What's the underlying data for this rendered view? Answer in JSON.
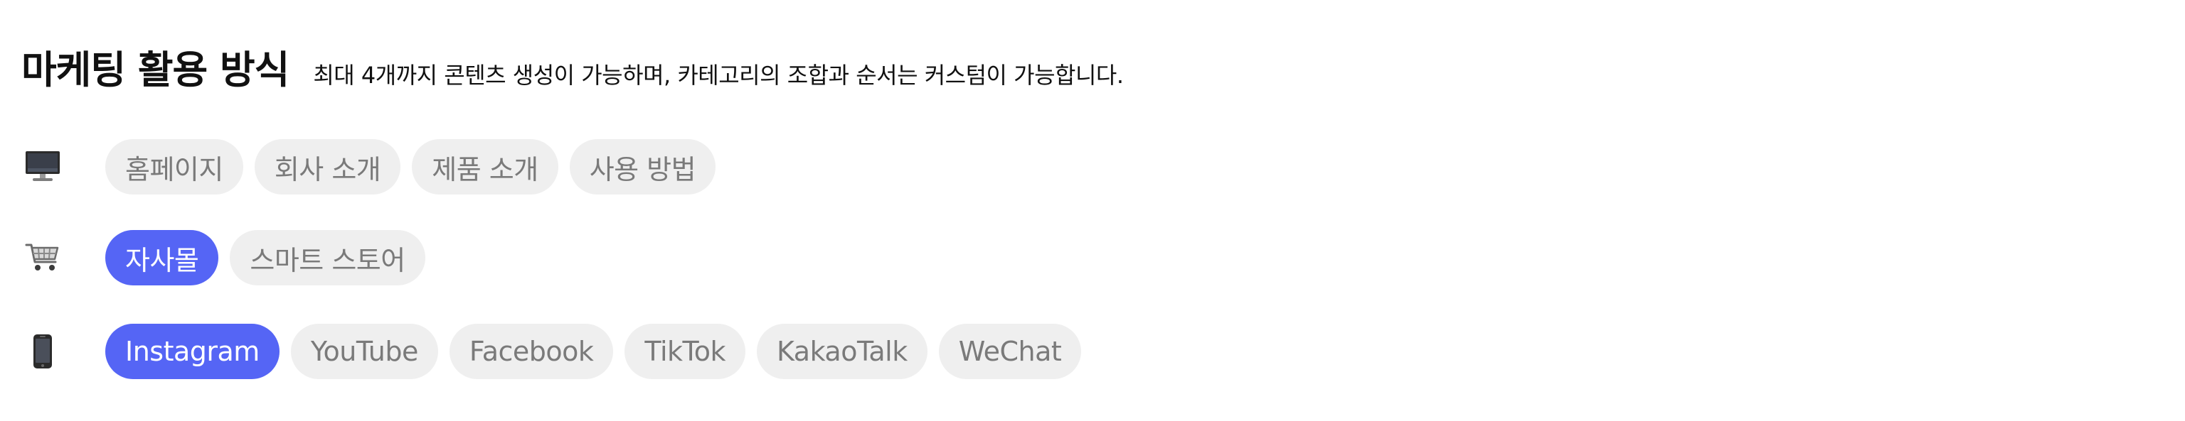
{
  "header": {
    "title": "마케팅 활용 방식",
    "subtitle": "최대 4개까지 콘텐츠 생성이 가능하며, 카테고리의 조합과 순서는 커스텀이 가능합니다."
  },
  "rows": [
    {
      "icon": "desktop-computer-icon",
      "chips": [
        {
          "label": "홈페이지",
          "selected": false
        },
        {
          "label": "회사 소개",
          "selected": false
        },
        {
          "label": "제품 소개",
          "selected": false
        },
        {
          "label": "사용 방법",
          "selected": false
        }
      ]
    },
    {
      "icon": "shopping-cart-icon",
      "chips": [
        {
          "label": "자사몰",
          "selected": true
        },
        {
          "label": "스마트 스토어",
          "selected": false
        }
      ]
    },
    {
      "icon": "mobile-phone-icon",
      "chips": [
        {
          "label": "Instagram",
          "selected": true
        },
        {
          "label": "YouTube",
          "selected": false
        },
        {
          "label": "Facebook",
          "selected": false
        },
        {
          "label": "TikTok",
          "selected": false
        },
        {
          "label": "KakaoTalk",
          "selected": false
        },
        {
          "label": "WeChat",
          "selected": false
        }
      ]
    }
  ],
  "colors": {
    "accent": "#5565f5",
    "chip_bg": "#efefef",
    "chip_text": "#7a7a7a"
  }
}
